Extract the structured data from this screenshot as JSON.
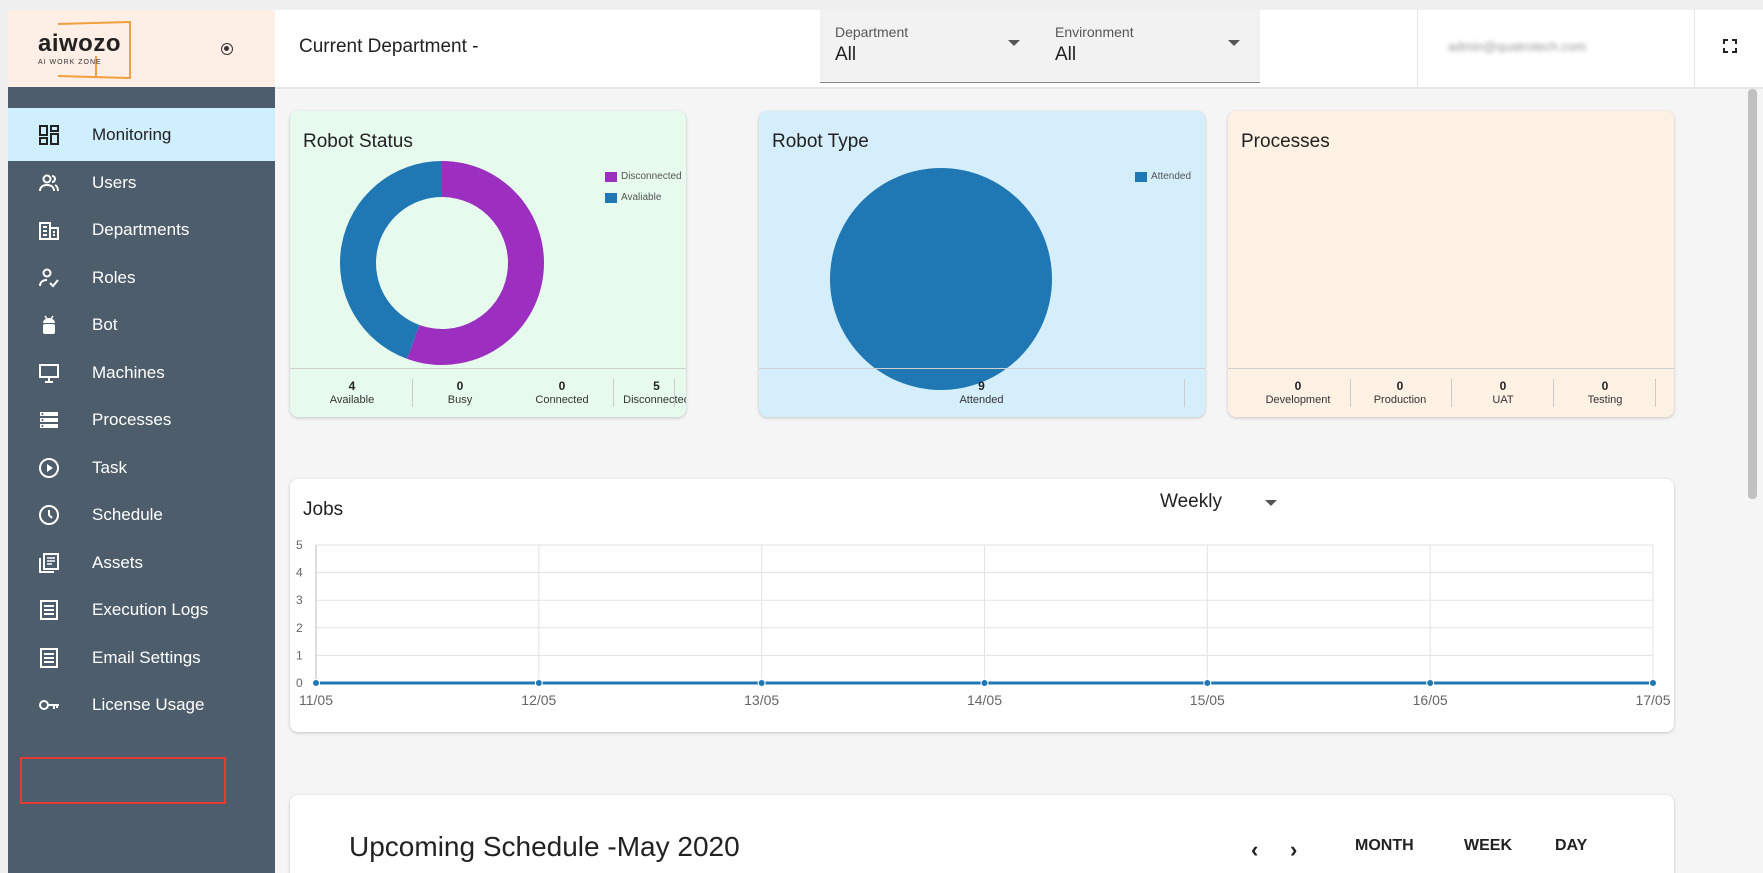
{
  "header": {
    "logo_text": "aiwozo",
    "logo_sub": "AI WORK ZONE",
    "current_department_label": "Current Department -",
    "department_select": {
      "label": "Department",
      "value": "All"
    },
    "environment_select": {
      "label": "Environment",
      "value": "All"
    },
    "user_email": "admin@quatrotech.com",
    "fullscreen_icon": "fullscreen-icon"
  },
  "sidebar": {
    "items": [
      {
        "label": "Monitoring",
        "icon": "dashboard-icon",
        "active": true
      },
      {
        "label": "Users",
        "icon": "users-icon"
      },
      {
        "label": "Departments",
        "icon": "building-icon"
      },
      {
        "label": "Roles",
        "icon": "user-check-icon"
      },
      {
        "label": "Bot",
        "icon": "android-icon"
      },
      {
        "label": "Machines",
        "icon": "monitor-icon"
      },
      {
        "label": "Processes",
        "icon": "list-icon"
      },
      {
        "label": "Task",
        "icon": "play-circle-icon"
      },
      {
        "label": "Schedule",
        "icon": "clock-icon"
      },
      {
        "label": "Assets",
        "icon": "library-icon"
      },
      {
        "label": "Execution Logs",
        "icon": "document-icon"
      },
      {
        "label": "Email Settings",
        "icon": "document-icon"
      },
      {
        "label": "License Usage",
        "icon": "key-icon",
        "highlighted": true
      }
    ]
  },
  "robot_status": {
    "title": "Robot Status",
    "legend": [
      "Disconnected",
      "Avaliable"
    ],
    "colors": {
      "Disconnected": "#9c2fbf",
      "Avaliable": "#1f77b4"
    },
    "stats": [
      {
        "value": "4",
        "label": "Available"
      },
      {
        "value": "0",
        "label": "Busy"
      },
      {
        "value": "0",
        "label": "Connected"
      },
      {
        "value": "5",
        "label": "Disconnected"
      }
    ]
  },
  "robot_type": {
    "title": "Robot Type",
    "legend": [
      "Attended"
    ],
    "stats": [
      {
        "value": "9",
        "label": "Attended"
      }
    ]
  },
  "processes": {
    "title": "Processes",
    "stats": [
      {
        "value": "0",
        "label": "Development"
      },
      {
        "value": "0",
        "label": "Production"
      },
      {
        "value": "0",
        "label": "UAT"
      },
      {
        "value": "0",
        "label": "Testing"
      }
    ]
  },
  "jobs": {
    "title": "Jobs",
    "period": "Weekly"
  },
  "chart_data": [
    {
      "type": "pie",
      "title": "Robot Status",
      "categories": [
        "Disconnected",
        "Avaliable"
      ],
      "values": [
        5,
        4
      ],
      "donut": true,
      "legend": "top-right"
    },
    {
      "type": "pie",
      "title": "Robot Type",
      "categories": [
        "Attended"
      ],
      "values": [
        9
      ],
      "legend": "top-right"
    },
    {
      "type": "line",
      "title": "Jobs",
      "x": [
        "11/05",
        "12/05",
        "13/05",
        "14/05",
        "15/05",
        "16/05",
        "17/05"
      ],
      "series": [
        {
          "values": [
            0,
            0,
            0,
            0,
            0,
            0,
            0
          ]
        }
      ],
      "ylim": [
        0,
        5
      ],
      "yticks": [
        "0",
        "1",
        "2",
        "3",
        "4",
        "5"
      ],
      "grid": true
    }
  ],
  "schedule": {
    "title": "Upcoming Schedule -May 2020",
    "prev": "‹",
    "next": "›",
    "buttons": [
      "MONTH",
      "WEEK",
      "DAY"
    ]
  }
}
